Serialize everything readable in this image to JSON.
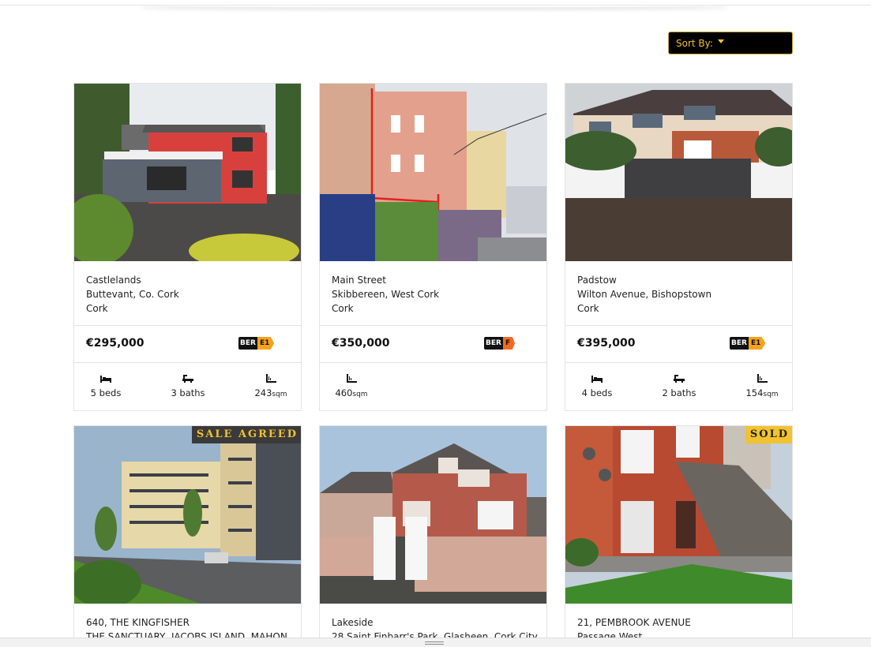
{
  "sort": {
    "label": "Sort By:"
  },
  "listings": [
    {
      "address": [
        "Castlelands",
        "Buttevant, Co. Cork",
        "Cork"
      ],
      "price": "€295,000",
      "ber": {
        "prefix": "BER",
        "rating": "E1",
        "color": "#f7a21b"
      },
      "beds": "5 beds",
      "baths": "3 baths",
      "area_num": "243",
      "area_unit": "sqm",
      "badge": ""
    },
    {
      "address": [
        "Main Street",
        "Skibbereen, West Cork",
        "Cork"
      ],
      "price": "€350,000",
      "ber": {
        "prefix": "BER",
        "rating": "F",
        "color": "#f26a21"
      },
      "beds": "",
      "baths": "",
      "area_num": "460",
      "area_unit": "sqm",
      "badge": ""
    },
    {
      "address": [
        "Padstow",
        "Wilton Avenue, Bishopstown",
        "Cork"
      ],
      "price": "€395,000",
      "ber": {
        "prefix": "BER",
        "rating": "E1",
        "color": "#f7a21b"
      },
      "beds": "4 beds",
      "baths": "2 baths",
      "area_num": "154",
      "area_unit": "sqm",
      "badge": ""
    },
    {
      "address": [
        "640, THE KINGFISHER",
        "THE SANCTUARY, JACOBS ISLAND, MAHON"
      ],
      "badge": "SALE AGREED"
    },
    {
      "address": [
        "Lakeside",
        "28 Saint Finbarr's Park, Glasheen, Cork City"
      ],
      "badge": ""
    },
    {
      "address": [
        "21, PEMBROOK AVENUE",
        "Passage West"
      ],
      "badge": "SOLD"
    }
  ],
  "icons": {
    "bed": "bed-icon",
    "bath": "bath-icon",
    "area": "area-icon"
  }
}
